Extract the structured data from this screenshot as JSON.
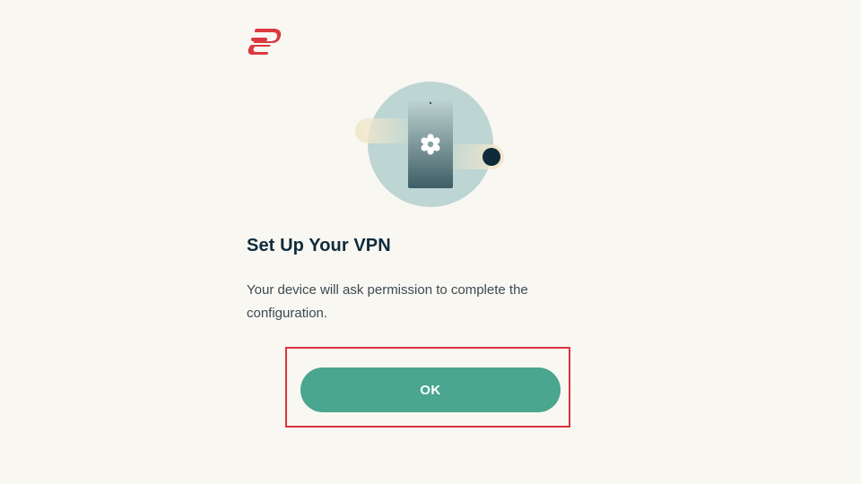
{
  "brand": {
    "logo_icon": "expressvpn-logo-icon",
    "logo_color": "#da3940"
  },
  "illustration": {
    "icon": "phone-with-gear-icon",
    "circle_color": "#bdd5d3",
    "switch_knob_color": "#0f2b3a"
  },
  "dialog": {
    "title": "Set Up Your VPN",
    "description": "Your device will ask permission to complete the configuration."
  },
  "actions": {
    "ok_label": "OK",
    "ok_color": "#4aa68e",
    "highlight_color": "#d9343c"
  }
}
